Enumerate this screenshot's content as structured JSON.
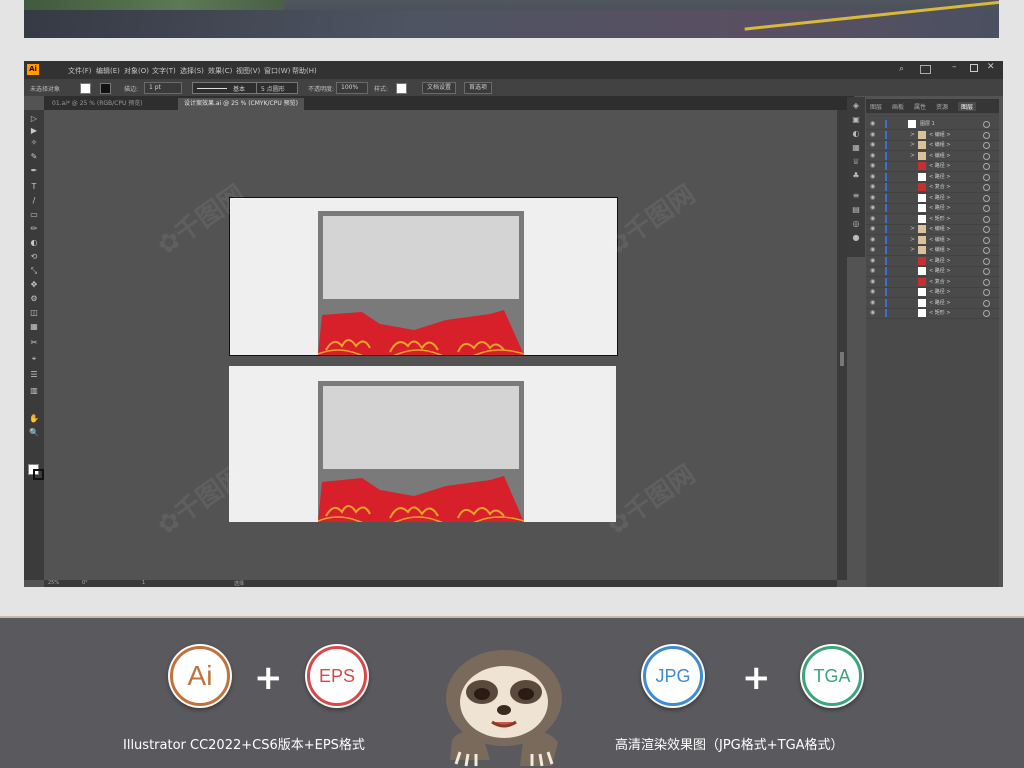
{
  "menubar": {
    "logo": "Ai",
    "items": [
      "文件(F)",
      "编辑(E)",
      "对象(O)",
      "文字(T)",
      "选择(S)",
      "效果(C)",
      "视图(V)",
      "窗口(W)",
      "帮助(H)"
    ]
  },
  "controlbar": {
    "selection": "未选择对象",
    "stroke_label": "描边:",
    "stroke_value": "1 pt",
    "brush_label": "基本",
    "point_label": "5 点圆形",
    "opacity_label": "不透明度:",
    "opacity_value": "100%",
    "style_label": "样式:",
    "doc_setup": "文档设置",
    "prefs": "首选项"
  },
  "tabs": [
    {
      "label": "01.ai* @ 25 % (RGB/CPU 预览)",
      "active": false
    },
    {
      "label": "设计案效果.ai @ 25 % (CMYK/CPU 预览)",
      "active": true
    }
  ],
  "tools": [
    "▷",
    "▶",
    "✧",
    "✎",
    "✒",
    "T",
    "/",
    "▭",
    "✏",
    "◐",
    "⟲",
    "⤡",
    "✥",
    "⚙",
    "◫",
    "▦",
    "✂",
    "⌖",
    "☰",
    "▥",
    "✋",
    "🔍"
  ],
  "statusbar": {
    "zoom": "25%",
    "angle": "0°",
    "page": "1",
    "tool": "选择"
  },
  "layers_panel": {
    "tabs": [
      "图层",
      "画板",
      "属性",
      "资源",
      "图层"
    ],
    "active_tab": "图层",
    "rows": [
      {
        "label": "图层 1",
        "thumb": "#ffffff",
        "arrow": "∨"
      },
      {
        "label": "< 编组 >",
        "thumb": "#d9c29a",
        "arrow": ">"
      },
      {
        "label": "< 编组 >",
        "thumb": "#d9c29a",
        "arrow": ">"
      },
      {
        "label": "< 编组 >",
        "thumb": "#d9c29a",
        "arrow": ">"
      },
      {
        "label": "< 路径 >",
        "thumb": "#c43030",
        "arrow": ""
      },
      {
        "label": "< 路径 >",
        "thumb": "#ffffff",
        "arrow": ""
      },
      {
        "label": "< 复合 >",
        "thumb": "#c43030",
        "arrow": ""
      },
      {
        "label": "< 路径 >",
        "thumb": "#ffffff",
        "arrow": ""
      },
      {
        "label": "< 路径 >",
        "thumb": "#ffffff",
        "arrow": ""
      },
      {
        "label": "< 矩形 >",
        "thumb": "#ffffff",
        "arrow": ""
      },
      {
        "label": "< 编组 >",
        "thumb": "#d9c29a",
        "arrow": ">"
      },
      {
        "label": "< 编组 >",
        "thumb": "#d9c29a",
        "arrow": ">"
      },
      {
        "label": "< 编组 >",
        "thumb": "#d9c29a",
        "arrow": ">"
      },
      {
        "label": "< 路径 >",
        "thumb": "#c43030",
        "arrow": ""
      },
      {
        "label": "< 路径 >",
        "thumb": "#ffffff",
        "arrow": ""
      },
      {
        "label": "< 复合 >",
        "thumb": "#c43030",
        "arrow": ""
      },
      {
        "label": "< 路径 >",
        "thumb": "#ffffff",
        "arrow": ""
      },
      {
        "label": "< 路径 >",
        "thumb": "#ffffff",
        "arrow": ""
      },
      {
        "label": "< 矩形 >",
        "thumb": "#ffffff",
        "arrow": ""
      }
    ]
  },
  "formats": {
    "left_badges": [
      {
        "label": "Ai",
        "color": "#c0723c"
      },
      {
        "label": "EPS",
        "color": "#d64a4a"
      }
    ],
    "right_badges": [
      {
        "label": "JPG",
        "color": "#3f8ad1"
      },
      {
        "label": "TGA",
        "color": "#3aa57a"
      }
    ],
    "plus": "+",
    "left_caption": "Illustrator CC2022+CS6版本+EPS格式",
    "right_caption": "高清渲染效果图（JPG格式+TGA格式）"
  },
  "colors": {
    "red": "#d8202a",
    "gold": "#e9a32a",
    "accent": "#ff9a00"
  }
}
